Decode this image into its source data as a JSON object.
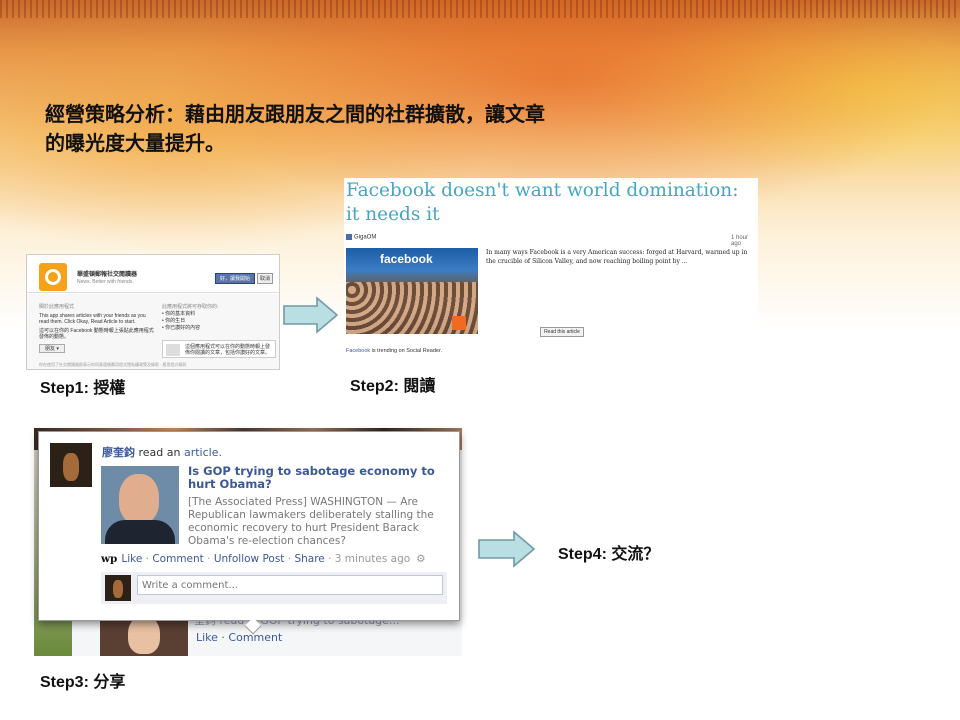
{
  "slide": {
    "title_line1": "經營策略分析：藉由朋友跟朋友之間的社群擴散，讓文章",
    "title_line2": "的曝光度大量提升。"
  },
  "steps": {
    "step1_label": "Step1: 授權",
    "step2_label": "Step2: 閱讀",
    "step3_label": "Step3: 分享",
    "step4_label": "Step4: 交流？"
  },
  "auth_dialog": {
    "app_name": "華盛頓郵報社交閱讀器",
    "app_tagline": "News. Better with friends.",
    "allow_button": "好，讓我開始",
    "cancel_button": "取消",
    "about_heading": "關於此應用程式",
    "about_text": "This app shares articles with your friends as you read them. Click Okay, Read Article to start.",
    "share_note": "這可以在你的 Facebook 動態時報上張貼此應用程式發佈的動態。",
    "audience": "朋友 ▾",
    "perm_heading": "此應用程式將可存取你的:",
    "perm_1": "• 你的基本資料",
    "perm_2": "• 你的生日",
    "perm_3": "• 你已讚好的內容",
    "timeline_box": "這個應用程式可以在你的動態時報上發佈你閱讀的文章，包括你讚好的文章。",
    "footer": "你在使用了社交閱讀器即表示你同意遵循應用程式隱私權政策及條款 · 應用程式條款"
  },
  "article_card": {
    "headline": "Facebook doesn't want world domination: it needs it",
    "source": "GigaOM",
    "time": "1 hour ago",
    "photo_text": "facebook",
    "excerpt": "In many ways Facebook is a very American success: forged at Harvard, warmed up in the crucible of Silicon Valley, and now reaching boiling point by ...",
    "read_button": "Read this article",
    "trending_link": "Facebook",
    "trending_text": " is trending on Social Reader."
  },
  "share_post": {
    "actor": "廖奎鈞",
    "verb": " read an ",
    "object": "article.",
    "headline": "Is GOP trying to sabotage economy to hurt Obama?",
    "summary": "[The Associated Press] WASHINGTON — Are Republican lawmakers deliberately stalling the economic recovery to hurt President Barack Obama's re-election chances?",
    "wp_glyph": "wp",
    "like": "Like",
    "comment": "Comment",
    "unfollow": "Unfollow Post",
    "share": "Share",
    "timestamp": "3 minutes ago",
    "gear_glyph": "⚙",
    "comment_placeholder": "Write a comment...",
    "behind_text": "奎鈞 read Is GOP trying to sabotage...",
    "behind_links": "Like · Comment"
  }
}
